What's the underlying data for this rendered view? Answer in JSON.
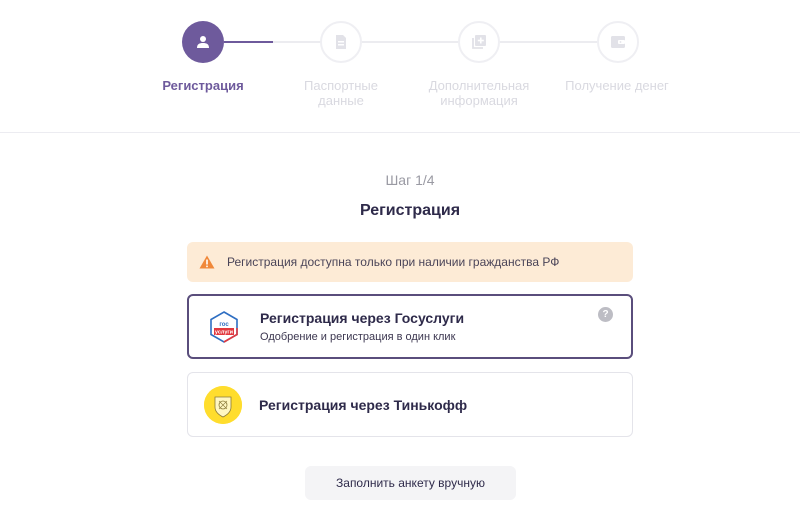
{
  "stepper": {
    "steps": [
      {
        "label": "Регистрация",
        "icon": "user-icon",
        "state": "active"
      },
      {
        "label": "Паспортные\nданные",
        "icon": "document-icon",
        "state": "inactive"
      },
      {
        "label": "Дополнительная\nинформация",
        "icon": "add-info-icon",
        "state": "inactive"
      },
      {
        "label": "Получение денег",
        "icon": "wallet-icon",
        "state": "inactive"
      }
    ]
  },
  "main": {
    "step_counter": "Шаг 1/4",
    "title": "Регистрация",
    "alert": {
      "icon": "warning-icon",
      "text": "Регистрация доступна только при наличии гражданства РФ"
    },
    "options": [
      {
        "title": "Регистрация через Госуслуги",
        "subtitle": "Одобрение и регистрация в один клик",
        "logo": "gosuslugi-logo",
        "logo_text_top": "гос",
        "logo_text_bottom": "услуги",
        "selected": true,
        "help": "?"
      },
      {
        "title": "Регистрация через Тинькофф",
        "logo": "tinkoff-logo",
        "selected": false
      }
    ],
    "manual_button": "Заполнить анкету вручную"
  },
  "colors": {
    "accent": "#6e5a9c",
    "alert_bg": "#fdebd6",
    "warning": "#f0883a",
    "gosuslugi_blue": "#2e6ec2",
    "gosuslugi_red": "#e2393f",
    "tinkoff_yellow": "#ffdd2d"
  }
}
